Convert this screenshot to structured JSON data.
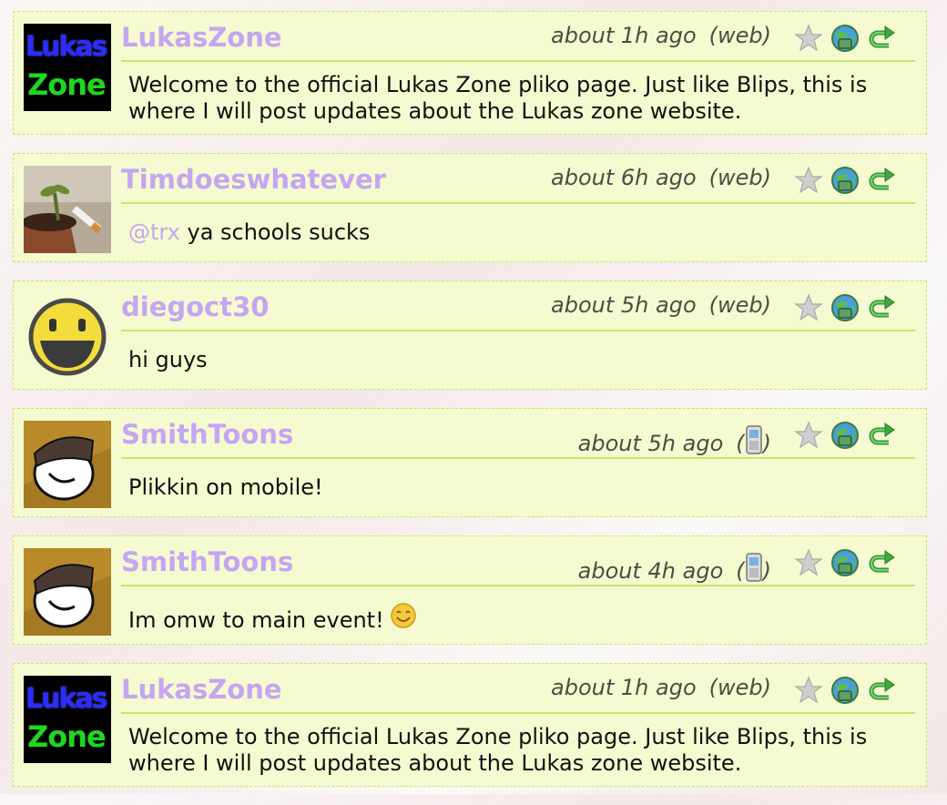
{
  "posts": [
    {
      "username": "LukasZone",
      "time": "about 1h ago",
      "source": "(web)",
      "text": "Welcome to the official Lukas Zone pliko page. Just like Blips, this is where I will post updates about the Lukas zone website.",
      "avatar_label_1": "Lukas",
      "avatar_label_2": "Zone"
    },
    {
      "username": "Timdoeswhatever",
      "time": "about 6h ago",
      "source": "(web)",
      "mention": "@trx",
      "text": "ya schools sucks"
    },
    {
      "username": "diegoct30",
      "time": "about 5h ago",
      "source": "(web)",
      "text": "hi guys"
    },
    {
      "username": "SmithToons",
      "time": "about 5h ago",
      "source_open": "(",
      "source_close": ")",
      "source_icon": "mobile-phone-icon",
      "text": "Plikkin on mobile!"
    },
    {
      "username": "SmithToons",
      "time": "about 4h ago",
      "source_open": "(",
      "source_close": ")",
      "source_icon": "mobile-phone-icon",
      "text": "Im omw to main event!",
      "emoji": "smiley-icon"
    },
    {
      "username": "LukasZone",
      "time": "about 1h ago",
      "source": "(web)",
      "text": "Welcome to the official Lukas Zone pliko page. Just like Blips, this is where I will post updates about the Lukas zone website.",
      "avatar_label_1": "Lukas",
      "avatar_label_2": "Zone"
    }
  ],
  "actions": {
    "favorite": "star-icon",
    "reply": "globe-reply-icon",
    "repost": "repost-arrow-icon"
  },
  "colors": {
    "card_bg": "#f5fad0",
    "card_border": "#c8e66a",
    "username": "#c4a6f2",
    "text": "#111111",
    "meta": "#4d4d44"
  }
}
